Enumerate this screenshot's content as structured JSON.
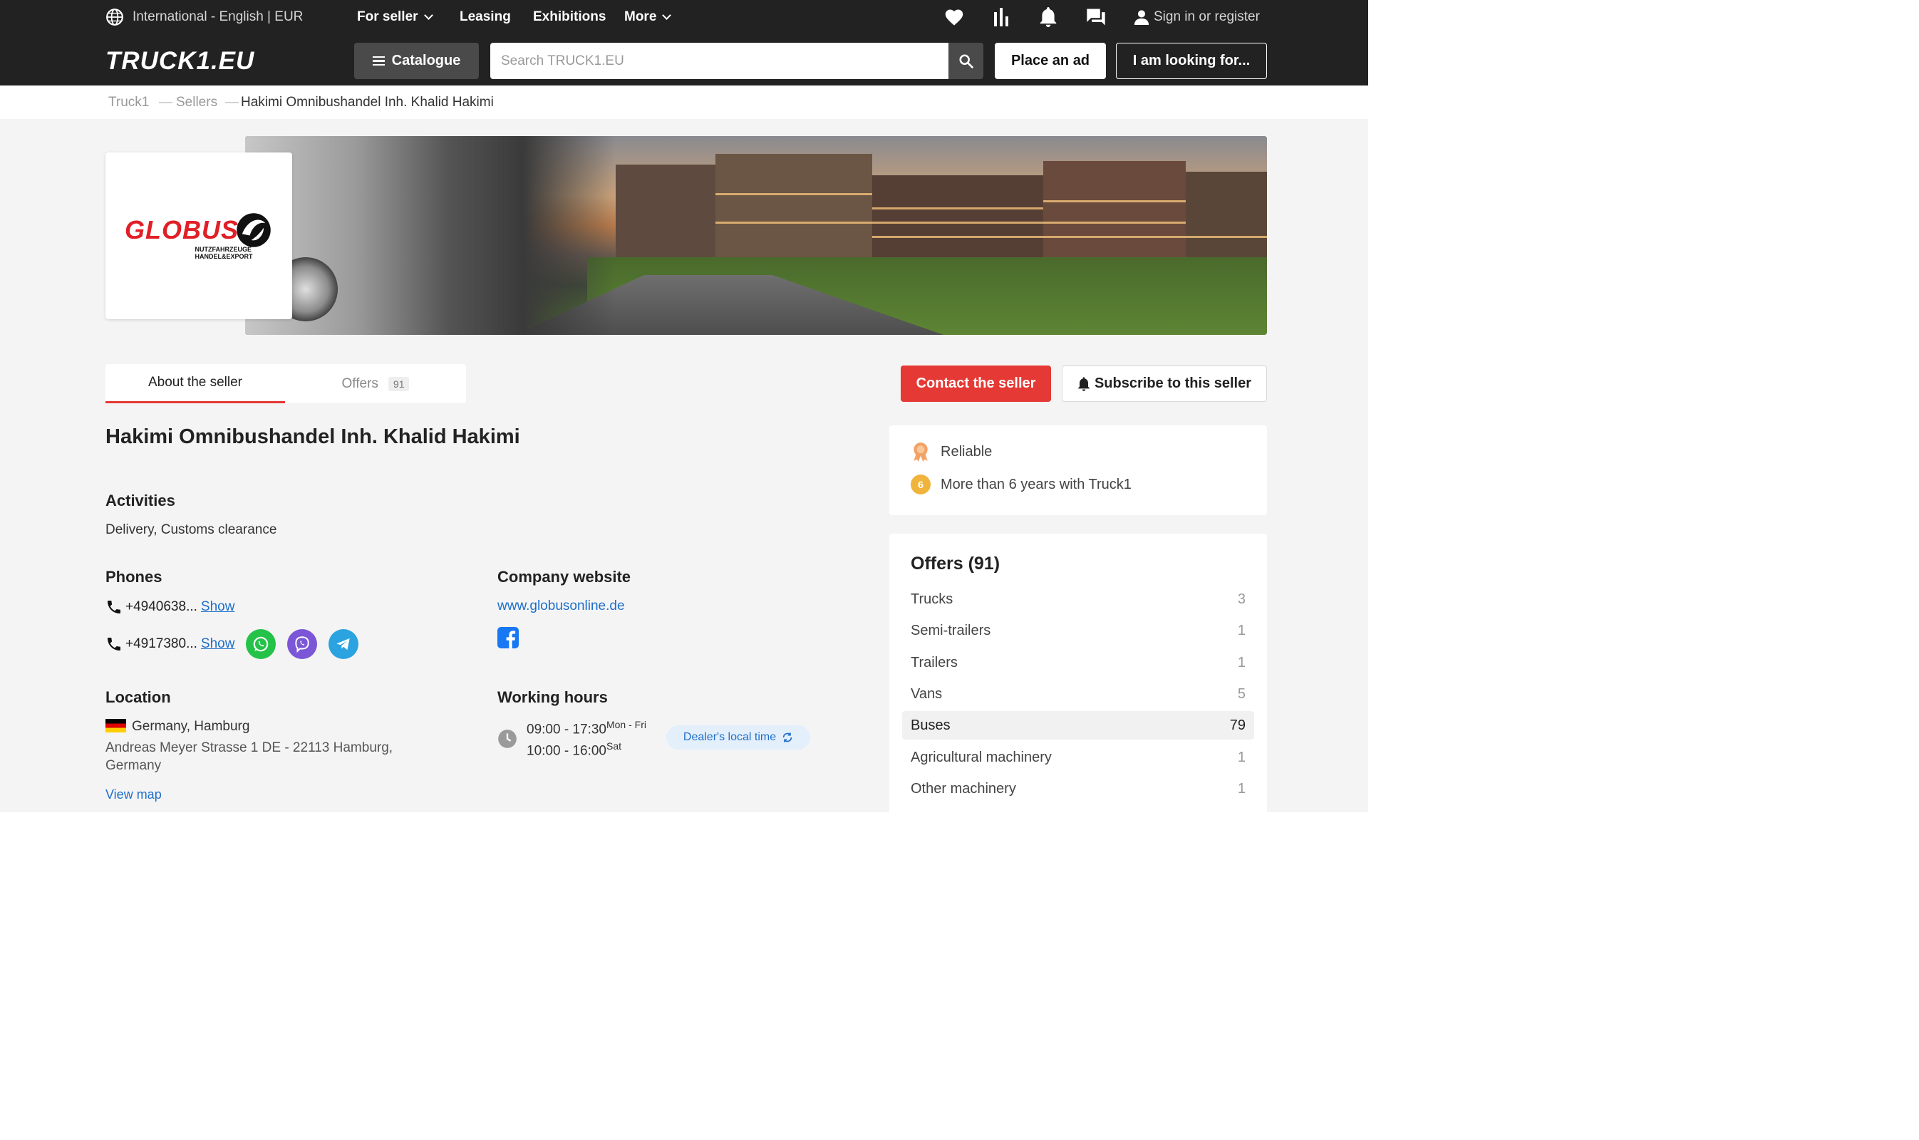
{
  "header": {
    "lang": "International - English | EUR",
    "nav": [
      "For seller",
      "Leasing",
      "Exhibitions",
      "More"
    ],
    "signin": "Sign in or register",
    "logo": "TRUCK1.EU",
    "catalogue": "Catalogue",
    "search_placeholder": "Search TRUCK1.EU",
    "place_ad": "Place an ad",
    "looking": "I am looking for..."
  },
  "breadcrumb": [
    "Truck1",
    "Sellers",
    "Hakimi Omnibushandel Inh. Khalid Hakimi"
  ],
  "logo_card": {
    "word": "GLOBUS",
    "line1": "NUTZFAHRZEUGE",
    "line2": "HANDEL&EXPORT"
  },
  "tabs": {
    "about": "About the seller",
    "offers": "Offers",
    "offers_count": "91"
  },
  "actions": {
    "contact": "Contact the seller",
    "subscribe": "Subscribe to this seller"
  },
  "seller": {
    "name": "Hakimi Omnibushandel Inh. Khalid Hakimi",
    "activities_h": "Activities",
    "activities": "Delivery, Customs clearance",
    "phones_h": "Phones",
    "phone1": "+4940638...",
    "phone2": "+4917380...",
    "show": "Show",
    "website_h": "Company website",
    "website": "www.globusonline.de",
    "location_h": "Location",
    "location_city": "Germany, Hamburg",
    "address1": "Andreas Meyer Strasse 1 DE - 22113 Hamburg,",
    "address2": "Germany",
    "view_map": "View map",
    "hours_h": "Working hours",
    "hours1": "09:00 - 17:30",
    "hours1_days": "Mon - Fri",
    "hours2": "10:00 - 16:00",
    "hours2_days": "Sat",
    "local_time": "Dealer's local time"
  },
  "features": {
    "reliable": "Reliable",
    "years_badge": "6",
    "years": "More than 6 years with Truck1"
  },
  "offers": {
    "title": "Offers (91)",
    "items": [
      {
        "label": "Trucks",
        "count": "3"
      },
      {
        "label": "Semi-trailers",
        "count": "1"
      },
      {
        "label": "Trailers",
        "count": "1"
      },
      {
        "label": "Vans",
        "count": "5"
      },
      {
        "label": "Buses",
        "count": "79"
      },
      {
        "label": "Agricultural machinery",
        "count": "1"
      },
      {
        "label": "Other machinery",
        "count": "1"
      }
    ]
  },
  "colors": {
    "header_bg": "#222222",
    "accent_red": "#e53935",
    "link_blue": "#1e6fc9",
    "brand_red": "#e01f26"
  }
}
